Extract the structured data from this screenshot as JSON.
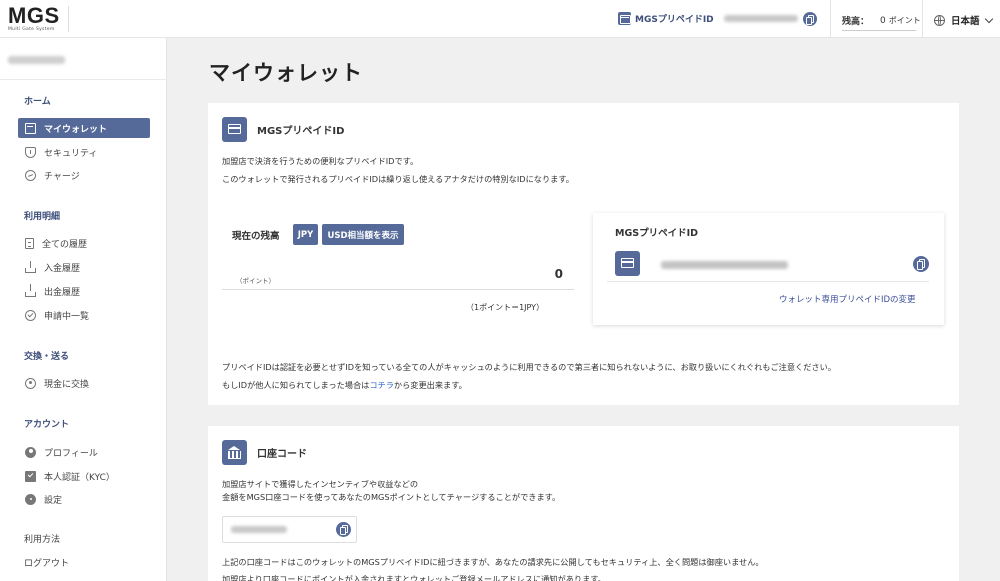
{
  "header": {
    "logo_main": "MGS",
    "logo_sub": "Multi Gate System",
    "prepaid_label": "MGSプリペイドID",
    "balance_label": "残高：",
    "balance_value": "0",
    "balance_unit": "ポイント",
    "language": "日本語"
  },
  "sidebar": {
    "sections": [
      {
        "title": "ホーム",
        "items": [
          {
            "label": "マイウォレット",
            "icon": "wallet-icon",
            "active": true
          },
          {
            "label": "セキュリティ",
            "icon": "shield-icon"
          },
          {
            "label": "チャージ",
            "icon": "charge-icon"
          }
        ]
      },
      {
        "title": "利用明細",
        "items": [
          {
            "label": "全ての履歴",
            "icon": "document-icon"
          },
          {
            "label": "入金履歴",
            "icon": "deposit-icon"
          },
          {
            "label": "出金履歴",
            "icon": "withdraw-icon"
          },
          {
            "label": "申請中一覧",
            "icon": "check-circle-icon"
          }
        ]
      },
      {
        "title": "交換・送る",
        "items": [
          {
            "label": "現金に交換",
            "icon": "exchange-icon"
          }
        ]
      },
      {
        "title": "アカウント",
        "items": [
          {
            "label": "プロフィール",
            "icon": "profile-icon"
          },
          {
            "label": "本人認証（KYC）",
            "icon": "kyc-icon"
          },
          {
            "label": "設定",
            "icon": "gear-icon"
          }
        ]
      }
    ],
    "links": [
      "利用方法",
      "ログアウト"
    ]
  },
  "main": {
    "page_title": "マイウォレット",
    "prepaid_card": {
      "title": "MGSプリペイドID",
      "desc_1": "加盟店で決済を行うための便利なプリペイドIDです。",
      "desc_2": "このウォレットで発行されるプリペイドIDは繰り返し使えるアナタだけの特別なIDになります。",
      "balance_title": "現在の残高",
      "btn_jpy": "JPY",
      "btn_usd": "USD相当額を表示",
      "points_label": "（ポイント）",
      "points_value": "0",
      "rate": "（1ポイント＝1JPY）",
      "id_box_title": "MGSプリペイドID",
      "id_change_link": "ウォレット専用プリペイドIDの変更",
      "note_1": "プリペイドIDは認証を必要とせずIDを知っている全ての人がキャッシュのように利用できるので第三者に知られないように、お取り扱いにくれぐれもご注意ください。",
      "note_2_prefix": "もしIDが他人に知られてしまった場合は",
      "note_2_link": "コチラ",
      "note_2_suffix": "から変更出来ます。"
    },
    "account_card": {
      "title": "口座コード",
      "desc_1": "加盟店サイトで獲得したインセンティブや収益などの",
      "desc_2": "金額をMGS口座コードを使ってあなたのMGSポイントとしてチャージすることができます。",
      "note_1": "上記の口座コードはこのウォレットのMGSプリペイドIDに紐づきますが、あなたの請求先に公開してもセキュリティ上、全く問題は御座いません。",
      "note_2": "加盟店より口座コードにポイントが入金されますとウォレットご登録メールアドレスに通知があります。"
    }
  },
  "colors": {
    "accent": "#566a9a",
    "link": "#3366cc",
    "background": "#f0f0f0"
  }
}
